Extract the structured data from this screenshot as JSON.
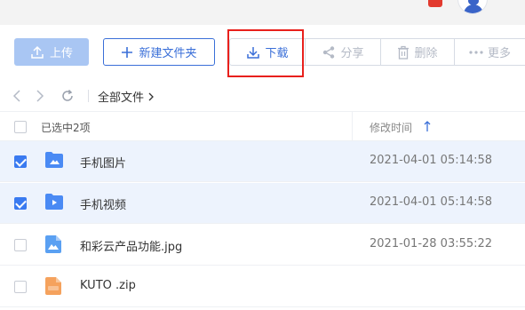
{
  "toolbar": {
    "upload_label": "上传",
    "new_folder_label": "新建文件夹",
    "download_label": "下载",
    "share_label": "分享",
    "delete_label": "删除",
    "more_label": "更多"
  },
  "breadcrumb": {
    "current": "全部文件"
  },
  "table": {
    "selected_text": "已选中2项",
    "time_header": "修改时间"
  },
  "files": [
    {
      "name": "手机图片",
      "time": "2021-04-01 05:14:58",
      "selected": true,
      "type": "image-folder"
    },
    {
      "name": "手机视频",
      "time": "2021-04-01 05:14:58",
      "selected": true,
      "type": "video-folder"
    },
    {
      "name": "和彩云产品功能.jpg",
      "time": "2021-01-28 03:55:22",
      "selected": false,
      "type": "image-file"
    },
    {
      "name": "KUTO .zip",
      "time": "",
      "selected": false,
      "type": "zip-file"
    }
  ],
  "colors": {
    "accent": "#3a6fd8",
    "selected_row": "#edf3fd",
    "checkbox_on": "#3a7af0",
    "highlight": "#e8201c",
    "zip_icon": "#f5a25d"
  },
  "icons": {
    "upload": "upload-icon",
    "new_folder": "plus-icon",
    "download": "download-icon",
    "share": "share-icon",
    "delete": "trash-icon",
    "more": "ellipsis-icon",
    "back": "chevron-left-icon",
    "forward": "chevron-right-icon",
    "refresh": "refresh-icon",
    "sort": "sort-up-arrow-icon"
  }
}
